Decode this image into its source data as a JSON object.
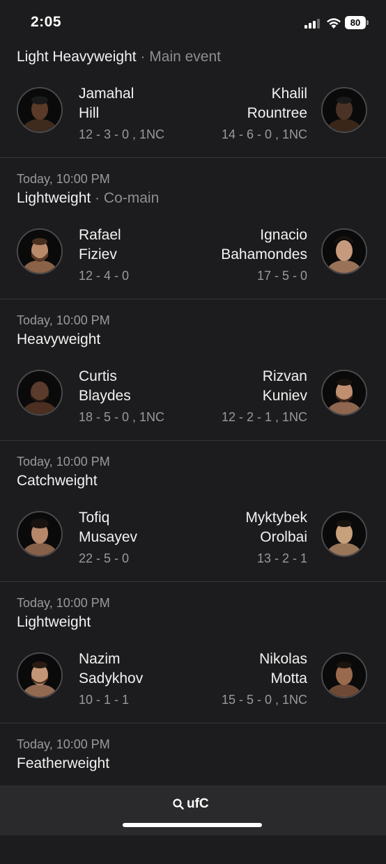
{
  "status_bar": {
    "time": "2:05",
    "battery": "80"
  },
  "fights": [
    {
      "time": "",
      "weight_class": "Light Heavyweight",
      "tag": "Main event",
      "left": {
        "first": "Jamahal",
        "last": "Hill",
        "record": "12 - 3 - 0 , 1NC",
        "skin": "#5a3a28"
      },
      "right": {
        "first": "Khalil",
        "last": "Rountree",
        "record": "14 - 6 - 0 , 1NC",
        "skin": "#4a3226"
      }
    },
    {
      "time": "Today, 10:00 PM",
      "weight_class": "Lightweight",
      "tag": "Co-main",
      "left": {
        "first": "Rafael",
        "last": "Fiziev",
        "record": "12 - 4 - 0",
        "skin": "#b98a6a"
      },
      "right": {
        "first": "Ignacio",
        "last": "Bahamondes",
        "record": "17 - 5 - 0",
        "skin": "#c69a7c"
      }
    },
    {
      "time": "Today, 10:00 PM",
      "weight_class": "Heavyweight",
      "tag": "",
      "left": {
        "first": "Curtis",
        "last": "Blaydes",
        "record": "18 - 5 - 0 , 1NC",
        "skin": "#5b3b2b"
      },
      "right": {
        "first": "Rizvan",
        "last": "Kuniev",
        "record": "12 - 2 - 1 , 1NC",
        "skin": "#c08f70"
      }
    },
    {
      "time": "Today, 10:00 PM",
      "weight_class": "Catchweight",
      "tag": "",
      "left": {
        "first": "Tofiq",
        "last": "Musayev",
        "record": "22 - 5 - 0",
        "skin": "#b7876a"
      },
      "right": {
        "first": "Myktybek",
        "last": "Orolbai",
        "record": "13 - 2 - 1",
        "skin": "#c7a07c"
      }
    },
    {
      "time": "Today, 10:00 PM",
      "weight_class": "Lightweight",
      "tag": "",
      "left": {
        "first": "Nazim",
        "last": "Sadykhov",
        "record": "10 - 1 - 1",
        "skin": "#c39677"
      },
      "right": {
        "first": "Nikolas",
        "last": "Motta",
        "record": "15 - 5 - 0 , 1NC",
        "skin": "#9a6a4e"
      }
    },
    {
      "time": "Today, 10:00 PM",
      "weight_class": "Featherweight",
      "tag": ""
    }
  ],
  "search": {
    "query": "ufC",
    "icon": "search-icon"
  },
  "icons": {
    "signal": "signal-icon",
    "wifi": "wifi-icon",
    "battery": "battery-icon"
  }
}
